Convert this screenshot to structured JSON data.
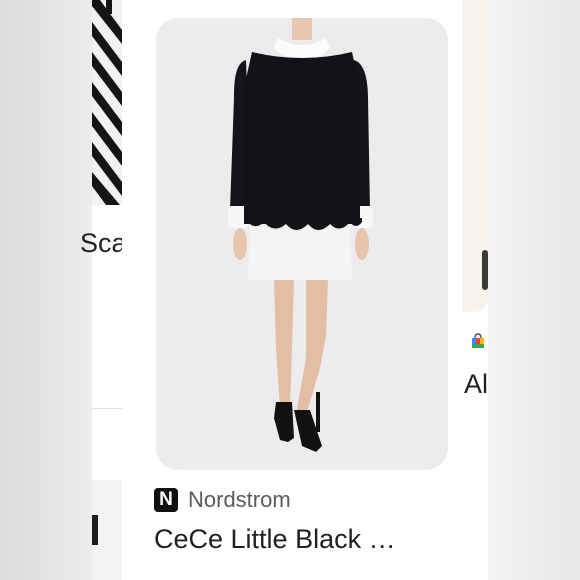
{
  "left_card": {
    "title_fragment": "Sca"
  },
  "main_card": {
    "store": {
      "logo_letter": "N",
      "name": "Nordstrom"
    },
    "product_title": "CeCe Little Black …"
  },
  "right_card": {
    "title_fragment": "Al"
  },
  "icons": {
    "store_logo": "nordstrom-logo",
    "shopping_bag": "shopping-bag-icon"
  },
  "colors": {
    "background": "#e9e9eb",
    "card": "#ffffff",
    "image_bg": "#ececee",
    "title_text": "#202124",
    "store_text": "#5a5a5a"
  }
}
